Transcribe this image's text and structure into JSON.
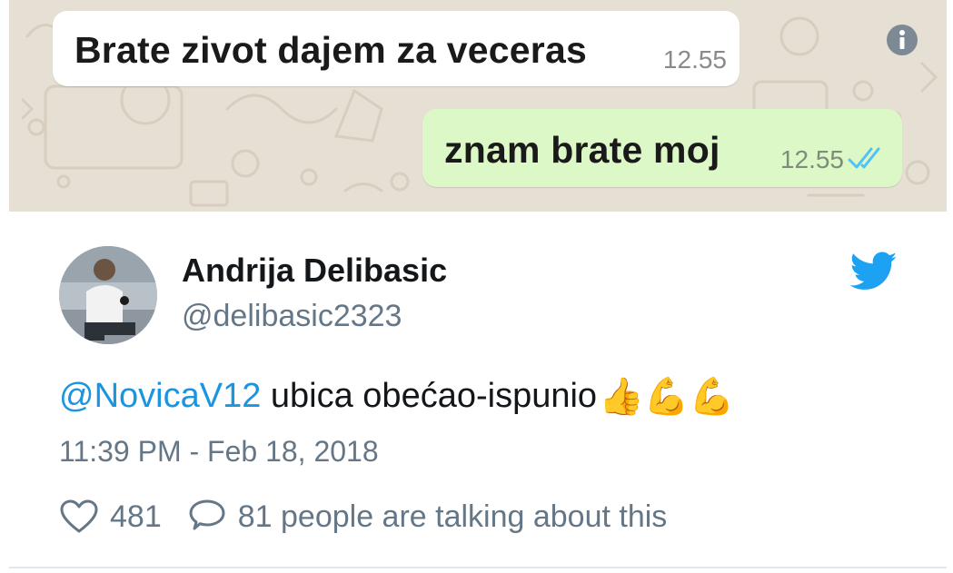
{
  "chat": {
    "incoming": {
      "text": "Brate zivot dajem za veceras",
      "time": "12.55"
    },
    "outgoing": {
      "text": "znam brate moj",
      "time": "12.55",
      "status": "read"
    },
    "colors": {
      "background": "#e6dfd3",
      "outgoing_bubble": "#dcf8c6",
      "read_ticks": "#4fc3f7"
    },
    "icons": [
      "info-icon",
      "double-check-icon"
    ]
  },
  "tweet": {
    "author_name": "Andrija Delibasic",
    "author_handle": "@delibasic2323",
    "mention": "@NovicaV12",
    "text": " ubica obećao-ispunio",
    "emojis": "👍💪💪",
    "timestamp": "11:39 PM - Feb 18, 2018",
    "likes": "481",
    "replies_text": "81 people are talking about this",
    "colors": {
      "link": "#1b95e0",
      "brand": "#1da1f2",
      "muted": "#657786"
    },
    "icons": [
      "twitter-bird-icon",
      "heart-icon",
      "speech-bubble-icon"
    ]
  }
}
